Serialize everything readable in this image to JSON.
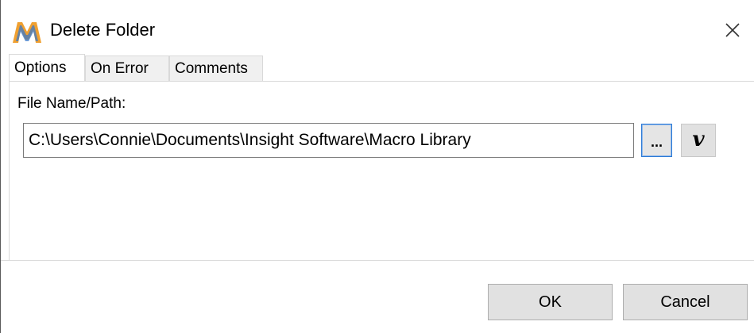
{
  "window": {
    "title": "Delete Folder",
    "app_icon": "macro-m-icon",
    "close_icon": "close-icon"
  },
  "tabs": [
    {
      "label": "Options",
      "active": true
    },
    {
      "label": "On Error",
      "active": false
    },
    {
      "label": "Comments",
      "active": false
    }
  ],
  "options": {
    "file_path_label": "File Name/Path:",
    "file_path_value": "C:\\Users\\Connie\\Documents\\Insight Software\\Macro Library",
    "browse_label": "...",
    "variable_label": "v"
  },
  "footer": {
    "ok_label": "OK",
    "cancel_label": "Cancel"
  },
  "colors": {
    "focus_border": "#2c7ad6",
    "button_face": "#e1e1e1",
    "icon_orange": "#f0a030",
    "icon_blue": "#3a78c8"
  }
}
